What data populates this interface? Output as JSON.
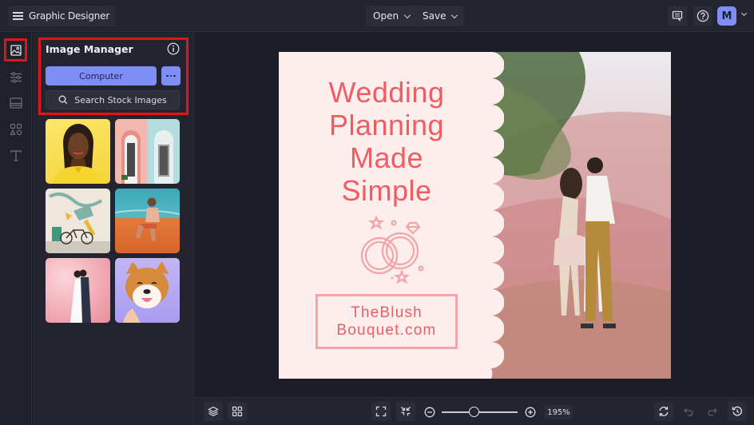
{
  "app": {
    "title": "Graphic Designer",
    "menu_icon": "hamburger-icon"
  },
  "toolbar": {
    "open_label": "Open",
    "save_label": "Save",
    "comment_icon": "comment-icon",
    "help_icon": "help-icon",
    "avatar_initial": "M",
    "accent_color": "#7f8df7"
  },
  "rail": {
    "items": [
      {
        "name": "images",
        "icon": "image-icon",
        "active": true
      },
      {
        "name": "adjustments",
        "icon": "sliders-icon",
        "active": false
      },
      {
        "name": "backgrounds",
        "icon": "background-icon",
        "active": false
      },
      {
        "name": "graphics",
        "icon": "shapes-icon",
        "active": false
      },
      {
        "name": "text",
        "icon": "text-icon",
        "active": false
      }
    ],
    "highlight_color": "#e0141a"
  },
  "panel": {
    "title": "Image Manager",
    "info_icon": "info-icon",
    "computer_label": "Computer",
    "more_icon": "ellipsis-icon",
    "search_label": "Search Stock Images",
    "thumbnails": [
      {
        "subject": "woman in yellow"
      },
      {
        "subject": "pastel doors"
      },
      {
        "subject": "mural with bicycle"
      },
      {
        "subject": "man sitting on sand"
      },
      {
        "subject": "couple among pink blossoms"
      },
      {
        "subject": "shiba inu dog"
      }
    ]
  },
  "design": {
    "headline": [
      "Wedding",
      "Planning",
      "Made",
      "Simple"
    ],
    "brand": [
      "TheBlush",
      "Bouquet.com"
    ],
    "text_color": "#ef5d63",
    "background_color": "#fdeeee",
    "graphic": "wedding-rings-icon",
    "photo": "couple kissing in field"
  },
  "bottombar": {
    "layers_icon": "layers-icon",
    "grid_icon": "grid-icon",
    "fit_icon": "fit-screen-icon",
    "shrink_icon": "shrink-icon",
    "zoom_out_icon": "zoom-out-icon",
    "zoom_in_icon": "zoom-in-icon",
    "zoom_value": "195%",
    "zoom_slider_fraction": 0.43,
    "refresh_icon": "refresh-icon",
    "undo_icon": "undo-icon",
    "redo_icon": "redo-icon",
    "history_icon": "history-icon"
  }
}
